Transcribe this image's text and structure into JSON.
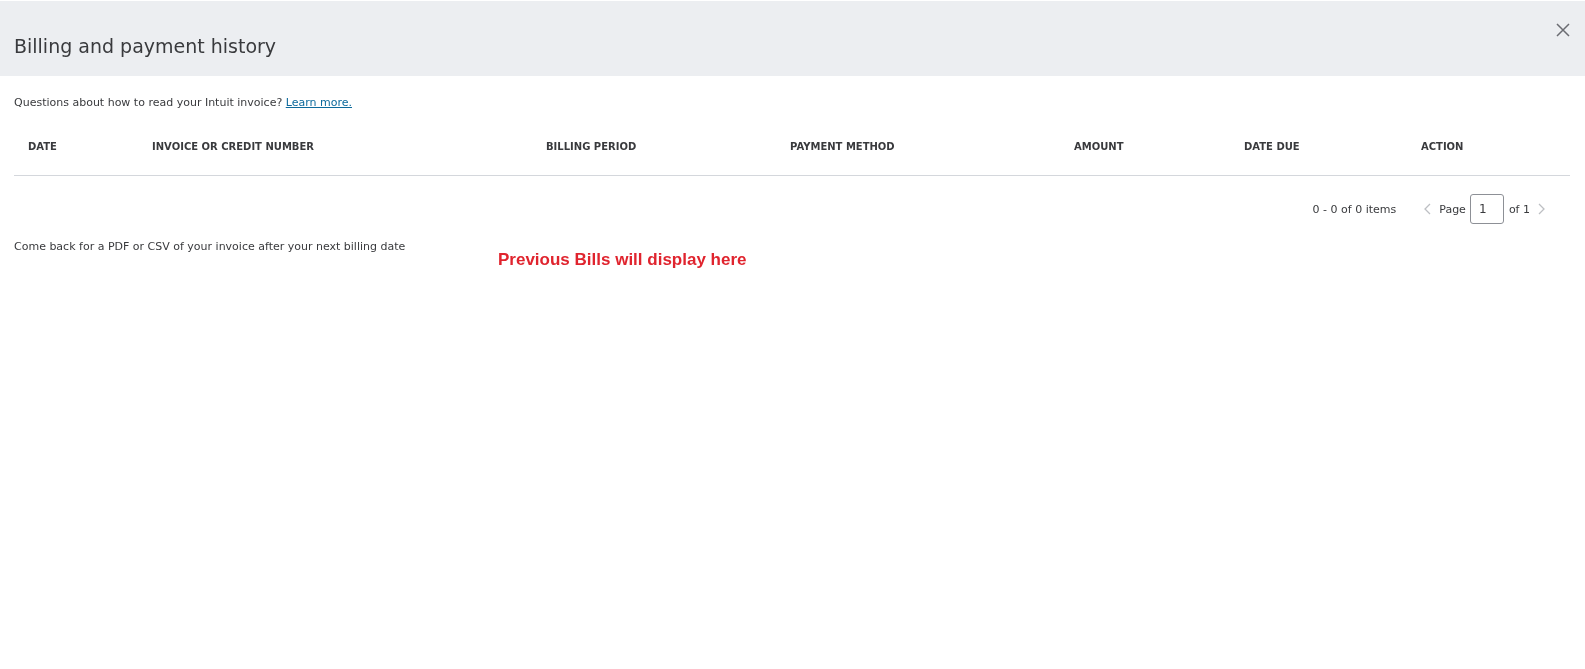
{
  "dialog": {
    "title": "Billing and payment history"
  },
  "help": {
    "text": "Questions about how to read your Intuit invoice?",
    "link": "Learn more."
  },
  "table": {
    "columns": [
      "DATE",
      "INVOICE OR CREDIT NUMBER",
      "BILLING PERIOD",
      "PAYMENT METHOD",
      "AMOUNT",
      "DATE DUE",
      "ACTION"
    ]
  },
  "pagination": {
    "summary": "0 - 0 of 0 items",
    "page_label": "Page",
    "page": "1",
    "of_label": "of 1",
    "prev_disabled": true,
    "next_disabled": true
  },
  "note": "Come back for a PDF or CSV of your invoice after your next billing date",
  "annotation": "Previous Bills will display here"
}
